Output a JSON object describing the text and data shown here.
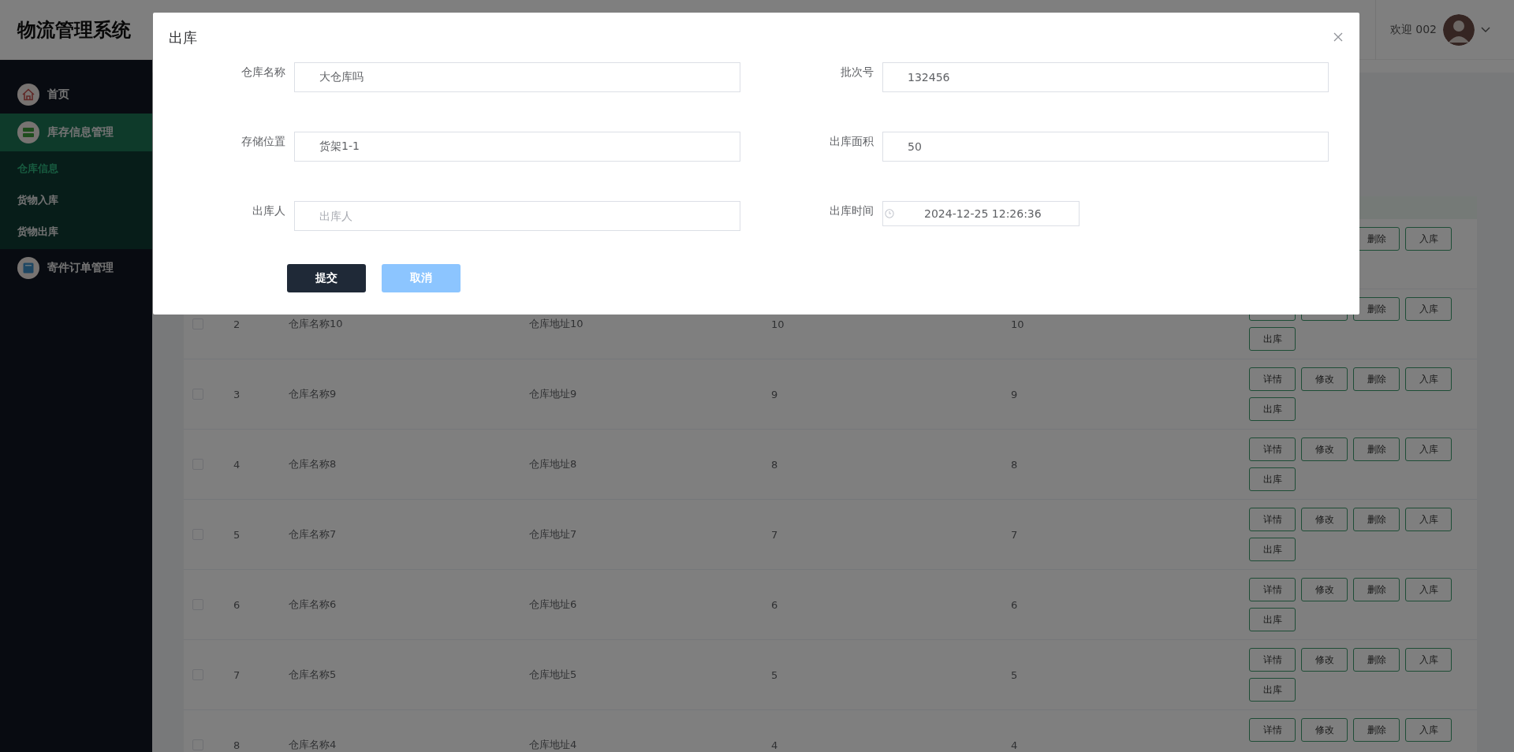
{
  "app": {
    "title": "物流管理系统"
  },
  "header": {
    "welcome": "欢迎 002"
  },
  "sidebar": {
    "items": [
      {
        "label": "首页",
        "expanded": false
      },
      {
        "label": "库存信息管理",
        "expanded": true,
        "children": [
          {
            "label": "仓库信息",
            "selected": true
          },
          {
            "label": "货物入库",
            "selected": false
          },
          {
            "label": "货物出库",
            "selected": false
          }
        ]
      },
      {
        "label": "寄件订单管理",
        "expanded": false
      }
    ]
  },
  "table": {
    "rows": [
      {
        "actions": [
          {
            "kind": "delete",
            "label": "删除"
          },
          {
            "kind": "stock-in",
            "label": "入库"
          }
        ]
      },
      {
        "checked": false,
        "cells": [
          "2",
          "仓库名称10",
          "仓库地址10",
          "10",
          "10"
        ],
        "actions": [
          {
            "kind": "detail"
          },
          {
            "kind": "edit"
          },
          {
            "kind": "delete",
            "label": "删除"
          },
          {
            "kind": "stock-in",
            "label": "入库"
          },
          {
            "kind": "stock-out",
            "label": "出库"
          }
        ]
      },
      {
        "checked": false,
        "cells": [
          "3",
          "仓库名称9",
          "仓库地址9",
          "9",
          "9"
        ],
        "actions": [
          {
            "kind": "detail",
            "label": "详情"
          },
          {
            "kind": "edit",
            "label": "修改"
          },
          {
            "kind": "delete",
            "label": "删除"
          },
          {
            "kind": "stock-in",
            "label": "入库"
          },
          {
            "kind": "stock-out",
            "label": "出库"
          }
        ]
      },
      {
        "checked": false,
        "cells": [
          "4",
          "仓库名称8",
          "仓库地址8",
          "8",
          "8"
        ],
        "actions": [
          {
            "kind": "detail",
            "label": "详情"
          },
          {
            "kind": "edit",
            "label": "修改"
          },
          {
            "kind": "delete",
            "label": "删除"
          },
          {
            "kind": "stock-in",
            "label": "入库"
          },
          {
            "kind": "stock-out",
            "label": "出库"
          }
        ]
      },
      {
        "checked": false,
        "cells": [
          "5",
          "仓库名称7",
          "仓库地址7",
          "7",
          "7"
        ],
        "actions": [
          {
            "kind": "detail",
            "label": "详情"
          },
          {
            "kind": "edit",
            "label": "修改"
          },
          {
            "kind": "delete",
            "label": "删除"
          },
          {
            "kind": "stock-in",
            "label": "入库"
          },
          {
            "kind": "stock-out",
            "label": "出库"
          }
        ]
      },
      {
        "checked": false,
        "cells": [
          "6",
          "仓库名称6",
          "仓库地址6",
          "6",
          "6"
        ],
        "actions": [
          {
            "kind": "detail",
            "label": "详情"
          },
          {
            "kind": "edit",
            "label": "修改"
          },
          {
            "kind": "delete",
            "label": "删除"
          },
          {
            "kind": "stock-in",
            "label": "入库"
          },
          {
            "kind": "stock-out",
            "label": "出库"
          }
        ]
      },
      {
        "checked": false,
        "cells": [
          "7",
          "仓库名称5",
          "仓库地址5",
          "5",
          "5"
        ],
        "actions": [
          {
            "kind": "detail",
            "label": "详情"
          },
          {
            "kind": "edit",
            "label": "修改"
          },
          {
            "kind": "delete",
            "label": "删除"
          },
          {
            "kind": "stock-in",
            "label": "入库"
          },
          {
            "kind": "stock-out",
            "label": "出库"
          }
        ]
      },
      {
        "checked": false,
        "cells": [
          "8",
          "仓库名称4",
          "仓库地址4",
          "4",
          "4"
        ],
        "actions": [
          {
            "kind": "detail",
            "label": "详情"
          },
          {
            "kind": "edit",
            "label": "修改"
          },
          {
            "kind": "delete",
            "label": "删除"
          },
          {
            "kind": "stock-in",
            "label": "入库"
          }
        ]
      }
    ]
  },
  "dialog": {
    "title": "出库",
    "fields": [
      {
        "kind": "text",
        "label": "仓库名称",
        "value": "大仓库吗"
      },
      {
        "kind": "text",
        "label": "批次号",
        "value": "132456"
      },
      {
        "kind": "text",
        "label": "存储位置",
        "value": "货架1-1"
      },
      {
        "kind": "text",
        "label": "出库面积",
        "value": "50"
      },
      {
        "kind": "text",
        "label": "出库人",
        "placeholder": "出库人"
      },
      {
        "kind": "datetime",
        "label": "出库时间",
        "value": "2024-12-25 12:26:36"
      }
    ],
    "buttons": [
      {
        "kind": "primary",
        "label": "提交"
      },
      {
        "kind": "secondary",
        "label": "取消"
      }
    ]
  }
}
